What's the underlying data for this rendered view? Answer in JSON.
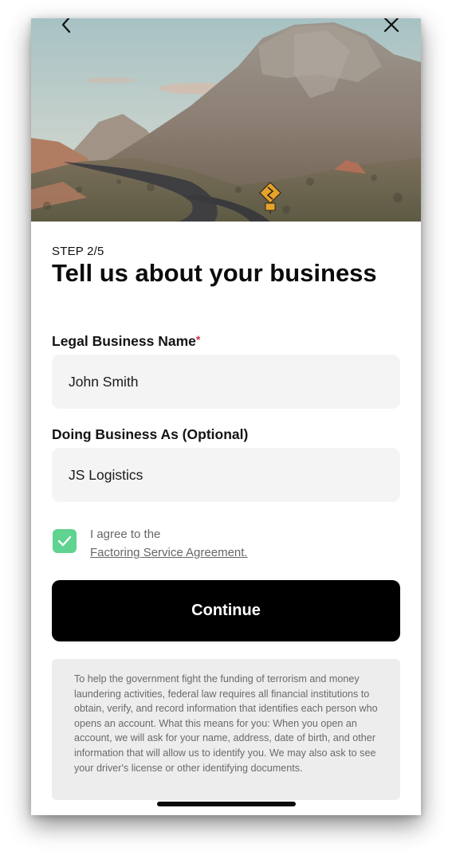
{
  "header": {
    "back_icon": "chevron-left-icon",
    "close_icon": "close-icon",
    "hero_image": "desert-mountain-road-photo"
  },
  "step": "STEP 2/5",
  "title": "Tell us about your business",
  "form": {
    "legal_name": {
      "label": "Legal Business Name",
      "required_marker": "*",
      "value": "John Smith"
    },
    "dba": {
      "label": "Doing Business As (Optional)",
      "value": "JS Logistics"
    }
  },
  "agreement": {
    "checked": true,
    "text": "I agree to the",
    "link": "Factoring Service Agreement."
  },
  "continue_label": "Continue",
  "disclosure": "To help the government fight the funding of terrorism and money laundering activities, federal law requires all financial institutions to obtain, verify, and record information that identifies each person who opens an account. What this means for you: When you open an account, we will ask for your name, address, date of birth, and other information that will allow us to identify you. We may also ask to see your driver's license or other identifying documents.",
  "colors": {
    "checkbox": "#5fd38f",
    "button": "#000000",
    "required": "#d0314a",
    "field_bg": "#f4f4f4",
    "disclosure_bg": "#ededed"
  }
}
